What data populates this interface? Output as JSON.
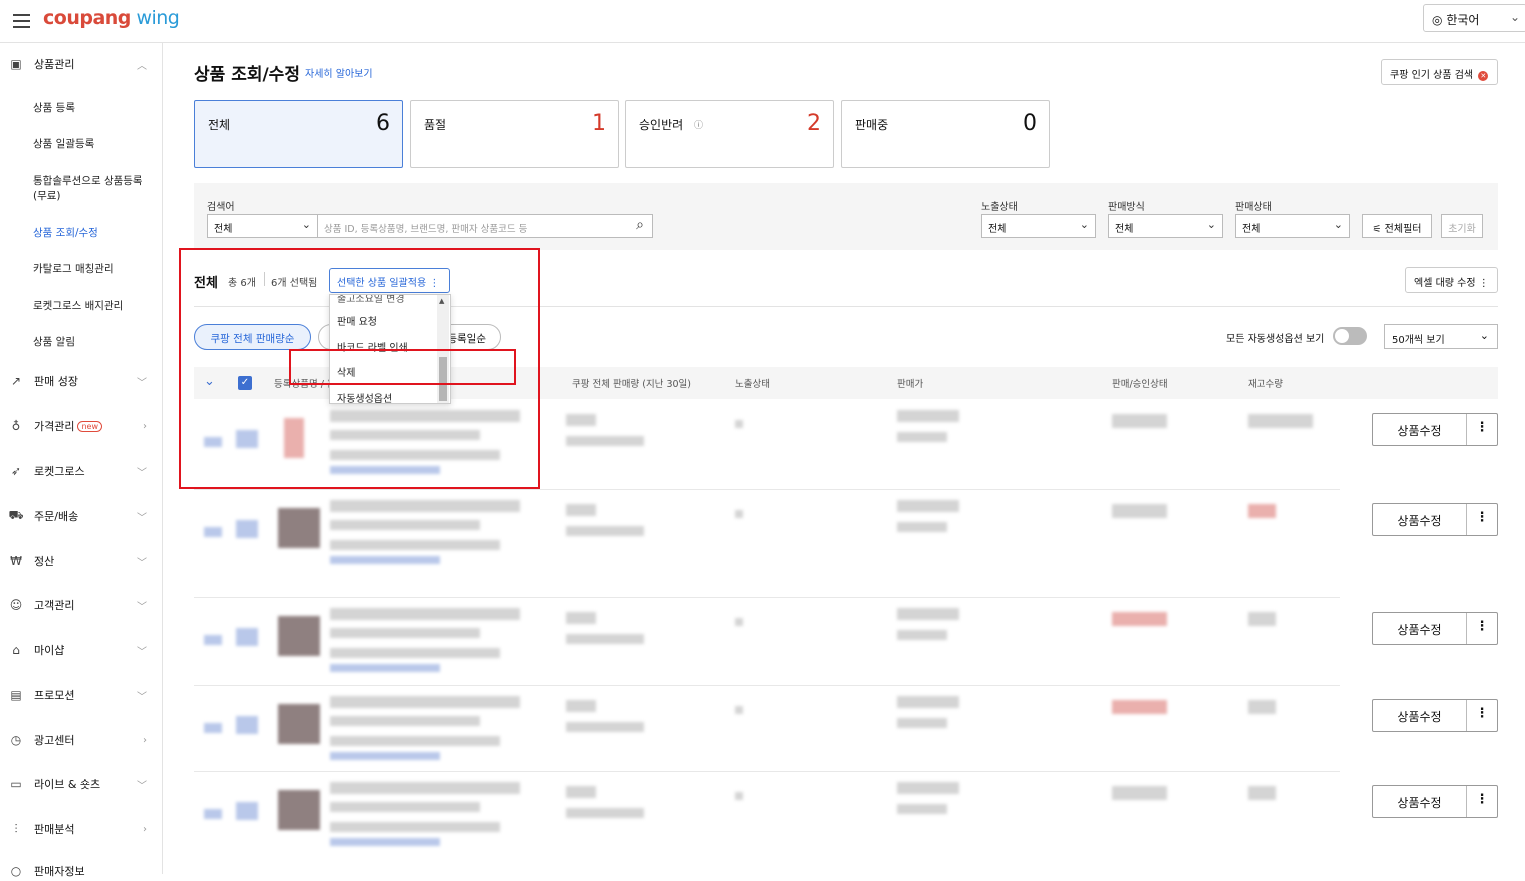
{
  "header": {
    "logo_main": "coupang",
    "logo_sub": " wing",
    "language": "한국어"
  },
  "sidebar": {
    "section": "상품관리",
    "sub_items": [
      "상품 등록",
      "상품 일괄등록",
      "통합솔루션으로 상품등록",
      "(무료)",
      "상품 조회/수정",
      "카탈로그 매칭관리",
      "로켓그로스 배지관리",
      "상품 알림"
    ],
    "items": [
      "판매 성장",
      "가격관리",
      "로켓그로스",
      "주문/배송",
      "정산",
      "고객관리",
      "마이샵",
      "프로모션",
      "광고센터",
      "라이브 & 숏츠",
      "판매분석",
      "판매자정보"
    ],
    "new_badge": "new"
  },
  "page": {
    "title": "상품 조회/수정",
    "learn_more": "자세히 알아보기",
    "hot_search": "쿠팡 인기 상품 검색"
  },
  "stats": [
    {
      "label": "전체",
      "value": "6"
    },
    {
      "label": "품절",
      "value": "1"
    },
    {
      "label": "승인반려",
      "value": "2"
    },
    {
      "label": "판매중",
      "value": "0"
    }
  ],
  "search": {
    "label": "검색어",
    "scope": "전체",
    "placeholder": "상품 ID, 등록상품명, 브랜드명, 판매자 상품코드 등",
    "exposure_label": "노출상태",
    "exposure": "전체",
    "method_label": "판매방식",
    "method": "전체",
    "status_label": "판매상태",
    "status": "전체",
    "filter_btn": "전체필터",
    "reset_btn": "초기화"
  },
  "list": {
    "heading": "전체",
    "total": "총 6개",
    "selected": "6개 선택됨",
    "bulk_btn": "선택한 상품 일괄적용 ⋮",
    "excel_btn": "엑셀 대량 수정 ⋮",
    "sort_active": "쿠팡 전체 판매량순",
    "sort_other": "등록일순",
    "auto_option_toggle": "모든 자동생성옵션 보기",
    "per_page": "50개씩 보기"
  },
  "bulk_menu": [
    "출고소요일 변경",
    "판매 요청",
    "바코드 라벨 인쇄",
    "삭제",
    "자동생성옵션"
  ],
  "table": {
    "columns": [
      "등록상품명 / 옵션",
      "쿠팡 전체 판매량 (지난 30일)",
      "노출상태",
      "판매가",
      "판매/승인상태",
      "재고수량"
    ],
    "edit_label": "상품수정",
    "row_count": 5
  }
}
